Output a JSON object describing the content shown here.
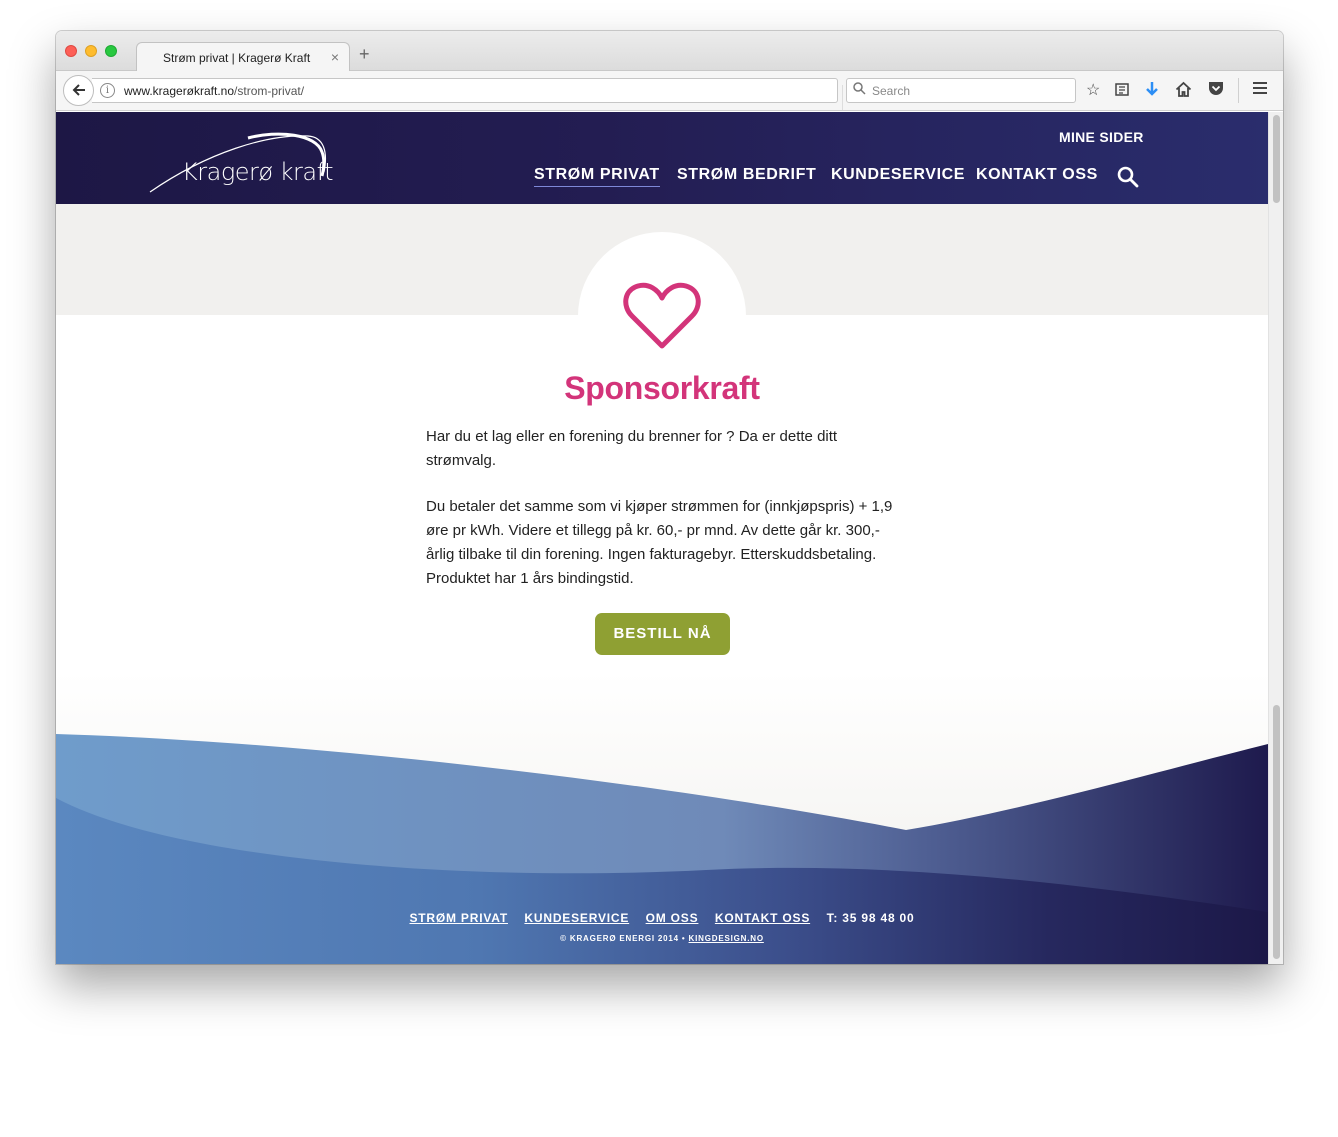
{
  "browser": {
    "tab_title": "Strøm privat | Kragerø Kraft",
    "tab_close": "×",
    "new_tab": "+",
    "url_domain": "www.kragerøkraft.no",
    "url_path": "/strom-privat/",
    "search_placeholder": "Search"
  },
  "header": {
    "logo_text": "Kragerø kraft",
    "mine_sider": "MINE SIDER",
    "nav": [
      "STRØM PRIVAT",
      "STRØM BEDRIFT",
      "KUNDESERVICE",
      "KONTAKT OSS"
    ]
  },
  "main": {
    "heading": "Sponsorkraft",
    "paragraph_1": "Har du et lag eller en forening du brenner for ? Da er dette ditt strømvalg.",
    "paragraph_2": "Du betaler det samme som vi kjøper strømmen for (innkjøpspris) + 1,9 øre pr kWh. Videre et tillegg på kr. 60,- pr mnd. Av dette går kr. 300,- årlig tilbake til din forening. Ingen fakturagebyr. Etterskuddsbetaling. Produktet har 1 års bindingstid.",
    "button_label": "BESTILL NÅ"
  },
  "footer": {
    "links": [
      "STRØM PRIVAT",
      "KUNDESERVICE",
      "OM OSS",
      "KONTAKT OSS"
    ],
    "phone": "T: 35 98 48 00",
    "copyright": "© KRAGERØ ENERGI 2014 •",
    "designer_link": "KINGDESIGN.NO"
  },
  "colors": {
    "header_bg": "#1d1745",
    "accent_pink": "#d3347a",
    "button_green": "#8fa033",
    "wave_blue": "#5b86bd",
    "wave_navy": "#1e1a4d"
  }
}
